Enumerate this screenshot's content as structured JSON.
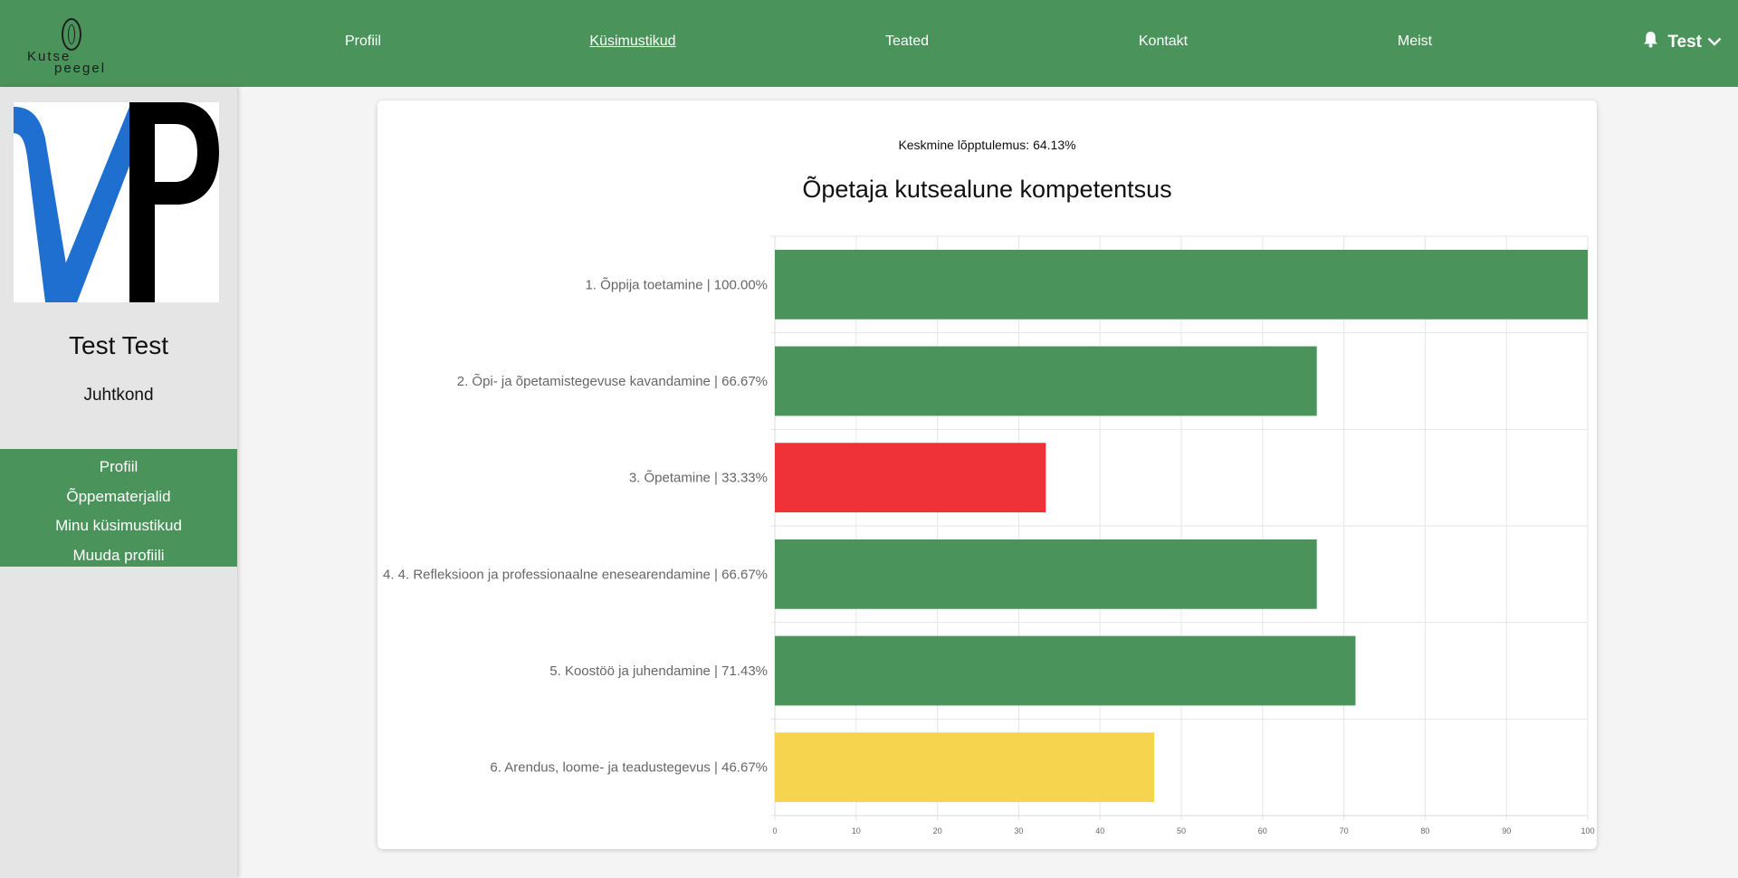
{
  "header": {
    "logo_line1": "Kutse",
    "logo_line2": "peegel",
    "nav": [
      {
        "label": "Profiil",
        "active": false
      },
      {
        "label": "Küsimustikud",
        "active": true
      },
      {
        "label": "Teated",
        "active": false
      },
      {
        "label": "Kontakt",
        "active": false
      },
      {
        "label": "Meist",
        "active": false
      }
    ],
    "user_label": "Test",
    "bell_icon": "bell-icon",
    "dropdown_icon": "chevron-down-icon"
  },
  "sidebar": {
    "name": "Test Test",
    "role": "Juhtkond",
    "menu": [
      {
        "label": "Profiil"
      },
      {
        "label": "Õppematerjalid"
      },
      {
        "label": "Minu küsimustikud"
      },
      {
        "label": "Muuda profiili"
      }
    ]
  },
  "main": {
    "average_label": "Keskmine lõpptulemus: 64.13%"
  },
  "colors": {
    "brand": "#4a935a",
    "good": "#4a935a",
    "bad": "#ee3237",
    "medium": "#f7d44e"
  },
  "chart_data": {
    "type": "bar",
    "orientation": "horizontal",
    "title": "Õpetaja kutsealune kompetentsus",
    "categories": [
      "1. Õppija toetamine | 100.00%",
      "2. Õpi- ja õpetamistegevuse kavandamine | 66.67%",
      "3. Õpetamine | 33.33%",
      "4. 4. Refleksioon ja professionaalne enesearendamine | 66.67%",
      "5. Koostöö ja juhendamine | 71.43%",
      "6. Arendus, loome- ja teadustegevus | 46.67%"
    ],
    "values": [
      100,
      66.67,
      33.33,
      66.67,
      71.43,
      46.67
    ],
    "bar_colors": [
      "#4a935a",
      "#4a935a",
      "#ee3237",
      "#4a935a",
      "#4a935a",
      "#f7d44e"
    ],
    "xlim": [
      0,
      100
    ],
    "xticks": [
      "0",
      "10",
      "20",
      "30",
      "40",
      "50",
      "60",
      "70",
      "80",
      "90",
      "100"
    ],
    "grid": true
  }
}
